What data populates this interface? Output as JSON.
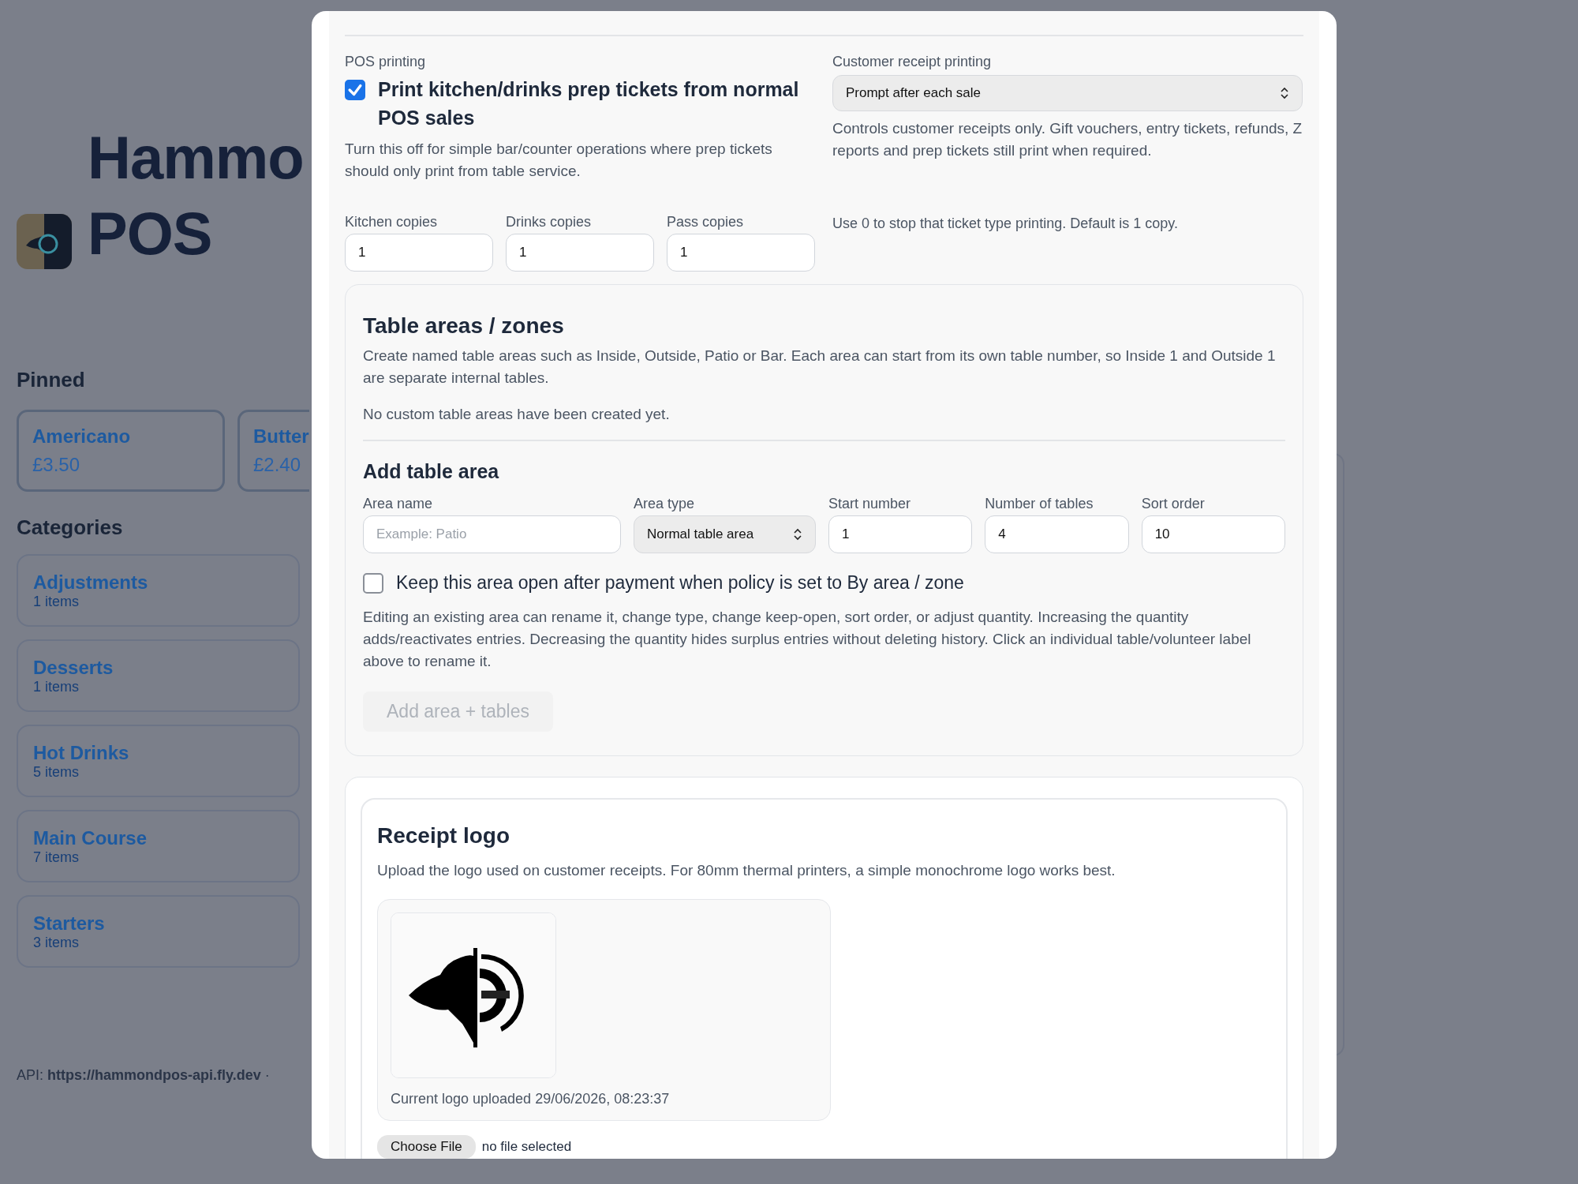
{
  "background": {
    "title_lines": [
      "Hammo",
      "POS"
    ],
    "pinned_heading": "Pinned",
    "pinned": [
      {
        "name": "Americano",
        "price": "£3.50"
      },
      {
        "name": "Butter",
        "price": "£2.40"
      }
    ],
    "categories_heading": "Categories",
    "categories": [
      {
        "name": "Adjustments",
        "count": "1 items"
      },
      {
        "name": "Desserts",
        "count": "1 items"
      },
      {
        "name": "Hot Drinks",
        "count": "5 items"
      },
      {
        "name": "Main Course",
        "count": "7 items"
      },
      {
        "name": "Starters",
        "count": "3 items"
      }
    ],
    "footer": "API: **https://hammondpos-api.fly.dev** ·"
  },
  "modal": {
    "pos_printing": {
      "label": "POS printing",
      "checkbox": {
        "label": "Print kitchen/drinks prep tickets from normal POS sales",
        "checked": true
      },
      "help": "Turn this off for simple bar/counter operations where prep tickets should only print from table service."
    },
    "receipt_printing": {
      "label": "Customer receipt printing",
      "value": "Prompt after each sale",
      "help": "Controls customer receipts only. Gift vouchers, entry tickets, refunds, Z reports and prep tickets still print when required."
    },
    "copies": [
      {
        "label": "Kitchen copies",
        "value": "1"
      },
      {
        "label": "Drinks copies",
        "value": "1"
      },
      {
        "label": "Pass copies",
        "value": "1"
      }
    ],
    "copies_help": "Use 0 to stop that ticket type printing. Default is 1 copy.",
    "table_areas": {
      "title": "Table areas / zones",
      "description": "Create named table areas such as Inside, Outside, Patio or Bar. Each area can start from its own table number, so Inside 1 and Outside 1 are separate internal tables.",
      "empty": "No custom table areas have been created yet.",
      "add_title": "Add table area",
      "fields": [
        {
          "kind": "text",
          "label": "Area name",
          "placeholder": "Example: Patio"
        },
        {
          "kind": "select",
          "label": "Area type",
          "value": "Normal table area"
        },
        {
          "kind": "text",
          "label": "Start number",
          "value": "1"
        },
        {
          "kind": "text",
          "label": "Number of tables",
          "value": "4"
        },
        {
          "kind": "text",
          "label": "Sort order",
          "value": "10"
        }
      ],
      "keep_open": {
        "label": "Keep this area open after payment when policy is set to By area / zone",
        "checked": false
      },
      "help": "Editing an existing area can rename it, change type, change keep-open, sort order, or adjust quantity. Increasing the quantity adds/reactivates entries. Decreasing the quantity hides surplus entries without deleting history. Click an individual table/volunteer label above to rename it.",
      "button": {
        "label": "Add area + tables",
        "disabled": true
      }
    },
    "receipt_logo": {
      "title": "Receipt logo",
      "description": "Upload the logo used on customer receipts. For 80mm thermal printers, a simple monochrome logo works best.",
      "uploaded": "Current logo uploaded 29/06/2026, 08:23:37",
      "file_button": "Choose File",
      "file_status": "no file selected"
    }
  }
}
